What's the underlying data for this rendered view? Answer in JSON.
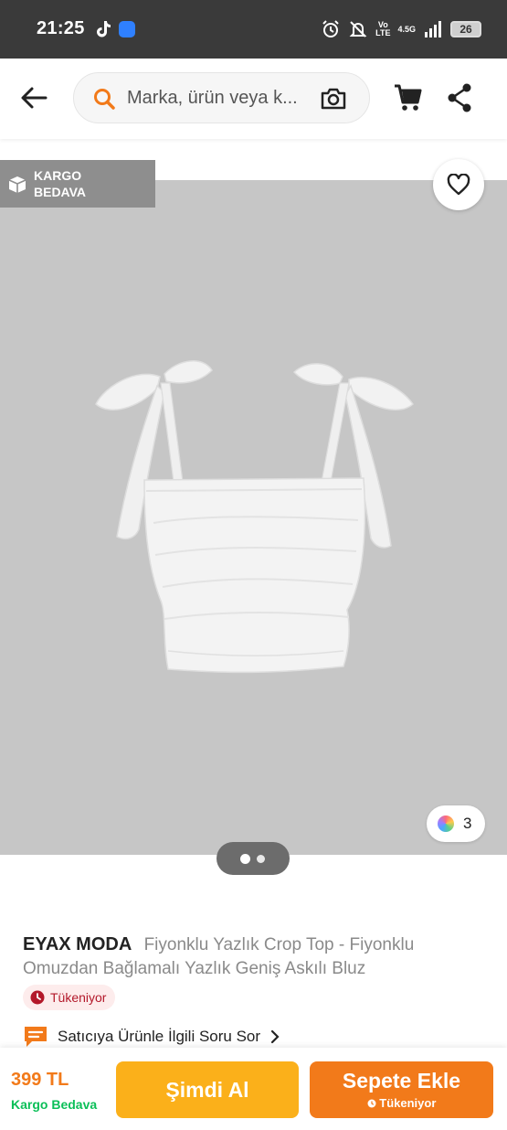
{
  "status_bar": {
    "time": "21:25",
    "volte_line1": "Vo",
    "volte_line2": "LTE",
    "network": "4.5G",
    "battery": "26"
  },
  "header": {
    "search_placeholder": "Marka, ürün veya k..."
  },
  "gallery": {
    "cargo_badge": "KARGO\nBEDAVA",
    "color_count": "3",
    "page_index": 1,
    "page_total": 2
  },
  "product": {
    "brand": "EYAX MODA",
    "title": "Fiyonklu Yazlık Crop Top - Fiyonklu Omuzdan Bağlamalı Yazlık Geniş Askılı Bluz",
    "stock_label": "Tükeniyor",
    "ask_seller": "Satıcıya Ürünle İlgili Soru Sor"
  },
  "bottom_bar": {
    "price": "399 TL",
    "shipping": "Kargo Bedava",
    "buy_now": "Şimdi Al",
    "add_to_cart": "Sepete Ekle",
    "add_to_cart_sub": "Tükeniyor"
  },
  "colors": {
    "brand_orange": "#f27a1a",
    "buy_yellow": "#fbb01a",
    "shipping_green": "#0bbf58",
    "stock_red": "#b3182a"
  }
}
